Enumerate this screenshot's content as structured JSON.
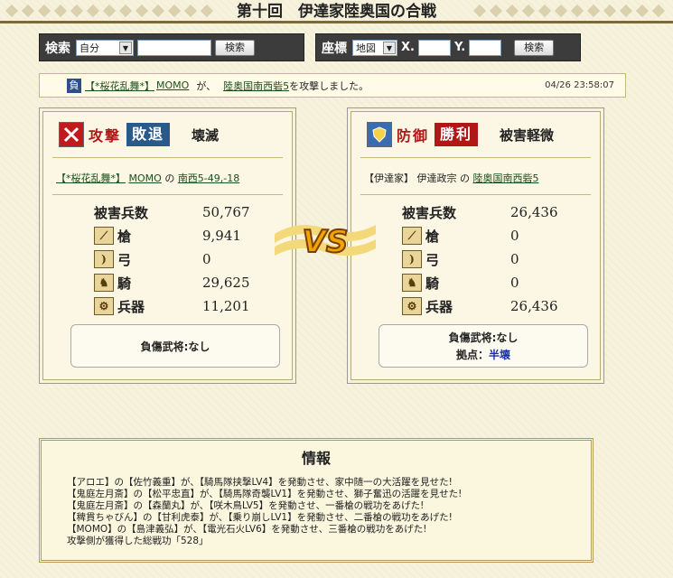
{
  "page_title": "第十回　伊達家陸奥国の合戦",
  "search_bar": {
    "label": "検索",
    "select_value": "自分",
    "text_value": "",
    "button_label": "検索"
  },
  "coord_bar": {
    "label": "座標",
    "select_value": "地図",
    "x_label": "X.",
    "y_label": "Y.",
    "x_value": "",
    "y_value": "",
    "button_label": "検索"
  },
  "news": {
    "flag": "負",
    "alliance": "【*桜花乱舞*】",
    "player": "MOMO",
    "particle": "が、",
    "target": "陸奥国南西砦5",
    "action": "を攻撃しました。",
    "time": "04/26 23:58:07"
  },
  "attack": {
    "icon": "swords-icon",
    "role": "攻撃",
    "result": "敗退",
    "result_color": "#2a5a8c",
    "damage": "壊滅",
    "alliance": "【*桜花乱舞*】",
    "player": "MOMO",
    "particle": "の",
    "location": "南西5-49,-18",
    "stats": [
      {
        "label": "被害兵数",
        "value": "50,767",
        "icon": ""
      },
      {
        "label": "槍",
        "value": "9,941",
        "icon": "spear-icon"
      },
      {
        "label": "弓",
        "value": "0",
        "icon": "bow-icon"
      },
      {
        "label": "騎",
        "value": "29,625",
        "icon": "horse-icon"
      },
      {
        "label": "兵器",
        "value": "11,201",
        "icon": "siege-weapon-icon"
      }
    ],
    "generals": "負傷武将:なし"
  },
  "defense": {
    "icon": "shield-icon",
    "role": "防御",
    "result": "勝利",
    "result_color": "#b01818",
    "damage": "被害軽微",
    "alliance": "【伊達家】",
    "player": "伊達政宗",
    "particle": "の",
    "location": "陸奥国南西砦5",
    "stats": [
      {
        "label": "被害兵数",
        "value": "26,436",
        "icon": ""
      },
      {
        "label": "槍",
        "value": "0",
        "icon": "spear-icon"
      },
      {
        "label": "弓",
        "value": "0",
        "icon": "bow-icon"
      },
      {
        "label": "騎",
        "value": "0",
        "icon": "horse-icon"
      },
      {
        "label": "兵器",
        "value": "26,436",
        "icon": "siege-weapon-icon"
      }
    ],
    "generals": "負傷武将:なし",
    "base_label": "拠点：",
    "base_value": "半壊"
  },
  "vs_label": "VS",
  "info": {
    "title": "情報",
    "lines": [
      "【アロエ】の【佐竹義重】が、【騎馬隊挟撃LV4】を発動させ、家中随一の大活躍を見せた!",
      "【鬼庭左月斎】の【松平忠直】が、【騎馬隊奇襲LV1】を発動させ、獅子奮迅の活躍を見せた!",
      "【鬼庭左月斎】の【森蘭丸】が、【咲木鳥LV5】を発動させ、一番槍の戦功をあげた!",
      "【稗貫ちゃびん】の【甘利虎泰】が、【乗り崩しLV1】を発動させ、二番槍の戦功をあげた!",
      "【MOMO】の【島津義弘】が、【電光石火LV6】を発動させ、三番槍の戦功をあげた!",
      "攻撃側が獲得した総戦功「528」"
    ]
  }
}
